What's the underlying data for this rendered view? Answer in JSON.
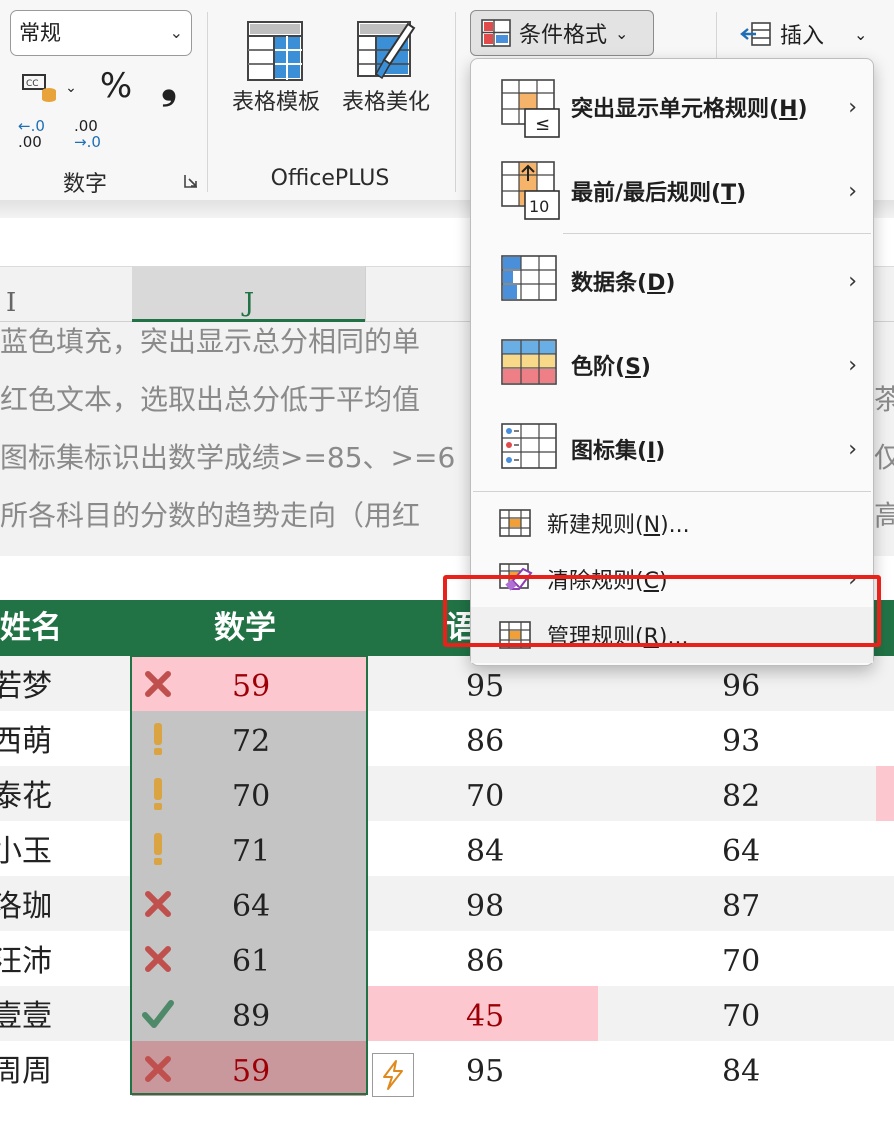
{
  "ribbon": {
    "number_format_value": "常规",
    "percent_glyph": "%",
    "comma_glyph": "❟",
    "dec_increase_top": "←.0",
    "dec_increase_bottom": ".00",
    "dec_decrease_top": ".00",
    "dec_decrease_bottom": "→.0",
    "number_group_label": "数字",
    "table_template_label": "表格模板",
    "table_beautify_label": "表格美化",
    "officeplus_group_label": "OfficePLUS",
    "conditional_format_label": "条件格式",
    "insert_label": "插入"
  },
  "sheet": {
    "col_I": "I",
    "col_J": "J",
    "notes": [
      "蓝色填充，突出显示总分相同的单",
      "红色文本，选取出总分低于平均值",
      "图标集标识出数学成绩>=85、>=6",
      "所各科目的分数的趋势走向（用红"
    ],
    "notes_right": [
      "",
      "茶",
      "仅",
      "高"
    ],
    "headers": {
      "name": "姓名",
      "math": "数学",
      "col3": "语"
    },
    "rows": [
      {
        "name": "若梦",
        "math": "59",
        "icon": "cross",
        "c3": "95",
        "c4": "96"
      },
      {
        "name": "西萌",
        "math": "72",
        "icon": "exclaim",
        "c3": "86",
        "c4": "93"
      },
      {
        "name": "泰花",
        "math": "70",
        "icon": "exclaim",
        "c3": "70",
        "c4": "82"
      },
      {
        "name": "小玉",
        "math": "71",
        "icon": "exclaim",
        "c3": "84",
        "c4": "64"
      },
      {
        "name": "洛珈",
        "math": "64",
        "icon": "cross",
        "c3": "98",
        "c4": "87"
      },
      {
        "name": "汪沛",
        "math": "61",
        "icon": "cross",
        "c3": "86",
        "c4": "70"
      },
      {
        "name": "壹壹",
        "math": "89",
        "icon": "check",
        "c3": "45",
        "c4": "70"
      },
      {
        "name": "周周",
        "math": "59",
        "icon": "cross",
        "c3": "95",
        "c4": "84"
      }
    ]
  },
  "menu": {
    "items": [
      {
        "label": "突出显示单元格规则(H)",
        "mn": "H",
        "arrow": "›"
      },
      {
        "label": "最前/最后规则(T)",
        "mn": "T",
        "arrow": "›"
      },
      {
        "label": "数据条(D)",
        "mn": "D",
        "arrow": "›"
      },
      {
        "label": "色阶(S)",
        "mn": "S",
        "arrow": "›"
      },
      {
        "label": "图标集(I)",
        "mn": "I",
        "arrow": "›"
      },
      {
        "label": "新建规则(N)...",
        "arrow": ""
      },
      {
        "label": "清除规则(C)",
        "arrow": "›"
      },
      {
        "label": "管理规则(R)...",
        "arrow": ""
      }
    ]
  },
  "colors": {
    "excel_green": "#217346",
    "red_fill": "#fcc7ce",
    "red_text": "#9c0006",
    "highlight_red": "#e8211b",
    "icon_cross": "#c0504d",
    "icon_exclaim": "#d9a441",
    "icon_check": "#4e8a6a"
  }
}
